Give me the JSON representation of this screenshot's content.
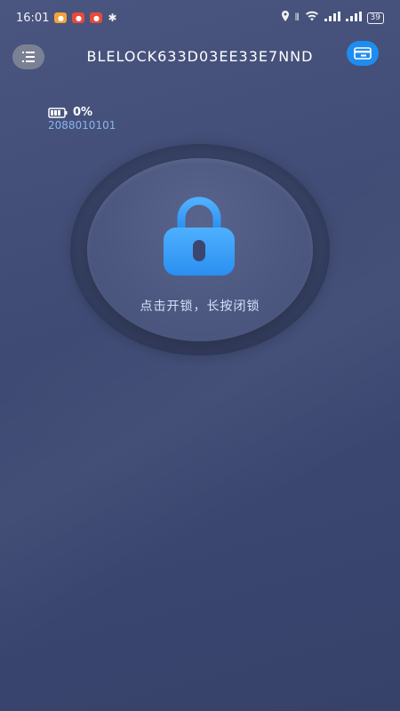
{
  "status_bar": {
    "time": "16:01",
    "battery_level": "39"
  },
  "header": {
    "title": "BLELOCK633D03EE33E7NND"
  },
  "device": {
    "battery_percent": "0%",
    "id": "2088010101"
  },
  "lock": {
    "hint": "点击开锁，长按闭锁"
  },
  "colors": {
    "accent": "#1f8cf0",
    "lock_blue": "#3aa0f5",
    "id_text": "#8ab4ee"
  }
}
